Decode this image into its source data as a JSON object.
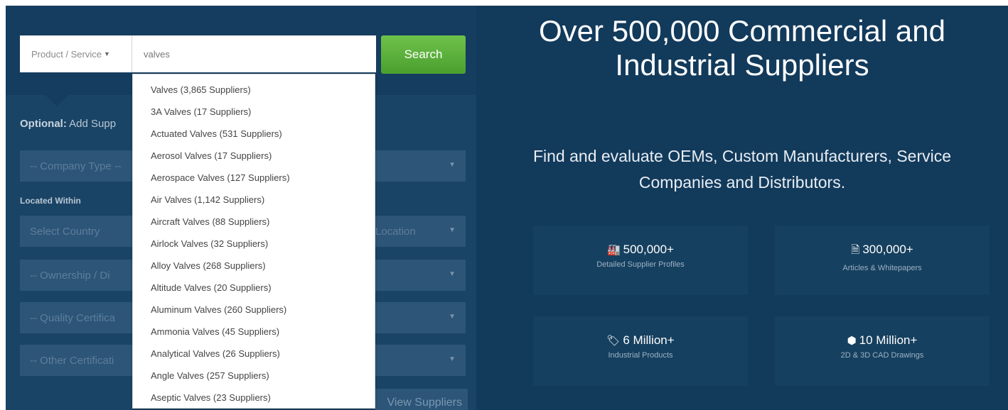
{
  "search": {
    "type_label": "Product / Service",
    "query_value": "valves",
    "button_label": "Search"
  },
  "filters": {
    "optional_bold": "Optional:",
    "optional_text": "Add Supp",
    "located_within": "Located Within",
    "fields": [
      {
        "placeholder": "-- Company Type --"
      },
      {
        "placeholder": "Select Country",
        "secondary": "Location"
      },
      {
        "placeholder": "-- Ownership / Di"
      },
      {
        "placeholder": "-- Quality Certifica"
      },
      {
        "placeholder": "-- Other Certificati"
      }
    ],
    "view_button": "View Suppliers"
  },
  "suggestions": [
    "Valves (3,865 Suppliers)",
    "3A Valves (17 Suppliers)",
    "Actuated Valves (531 Suppliers)",
    "Aerosol Valves (17 Suppliers)",
    "Aerospace Valves (127 Suppliers)",
    "Air Valves (1,142 Suppliers)",
    "Aircraft Valves (88 Suppliers)",
    "Airlock Valves (32 Suppliers)",
    "Alloy Valves (268 Suppliers)",
    "Altitude Valves (20 Suppliers)",
    "Aluminum Valves (260 Suppliers)",
    "Ammonia Valves (45 Suppliers)",
    "Analytical Valves (26 Suppliers)",
    "Angle Valves (257 Suppliers)",
    "Aseptic Valves (23 Suppliers)"
  ],
  "hero": {
    "headline": "Over 500,000 Commercial and Industrial Suppliers",
    "subheadline": "Find and evaluate OEMs, Custom Manufacturers, Service Companies and Distributors."
  },
  "stats": [
    {
      "icon": "factory-icon",
      "glyph": "🏭",
      "value": "500,000+",
      "label": "Detailed Supplier Profiles"
    },
    {
      "icon": "document-icon",
      "glyph": "🗎",
      "value": "300,000+",
      "label": "Articles & Whitepapers"
    },
    {
      "icon": "tag-icon",
      "glyph": "🏷",
      "value": "6 Million+",
      "label": "Industrial Products"
    },
    {
      "icon": "cube-icon",
      "glyph": "⬢",
      "value": "10 Million+",
      "label": "2D & 3D CAD Drawings"
    }
  ],
  "colors": {
    "background": "#123a5b",
    "panel": "#1a4466",
    "search_button": "#5aae3a"
  }
}
